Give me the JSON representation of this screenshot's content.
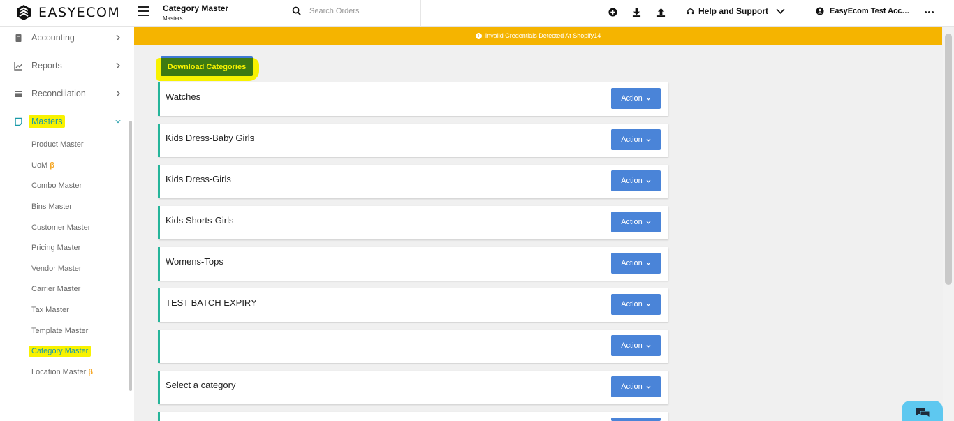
{
  "brand": {
    "name": "EASYECOM"
  },
  "header": {
    "title": "Category Master",
    "subtitle": "Masters",
    "search_placeholder": "Search Orders",
    "help_label": "Help and Support",
    "account_label": "EasyEcom Test Account"
  },
  "banner": {
    "text": "Invalid Credentials Detected At Shopify14"
  },
  "sidebar": {
    "items": [
      {
        "label": "Accounting",
        "icon": "receipt-icon"
      },
      {
        "label": "Reports",
        "icon": "chart-line-icon"
      },
      {
        "label": "Reconciliation",
        "icon": "wallet-icon"
      },
      {
        "label": "Masters",
        "icon": "note-icon"
      }
    ],
    "sub_items": [
      {
        "label": "Product Master"
      },
      {
        "label": "UoM",
        "beta": "β"
      },
      {
        "label": "Combo Master"
      },
      {
        "label": "Bins Master"
      },
      {
        "label": "Customer Master"
      },
      {
        "label": "Pricing Master"
      },
      {
        "label": "Vendor Master"
      },
      {
        "label": "Carrier Master"
      },
      {
        "label": "Tax Master"
      },
      {
        "label": "Template Master"
      },
      {
        "label": "Category Master"
      },
      {
        "label": "Location Master",
        "beta": "β"
      }
    ]
  },
  "main": {
    "download_label": "Download Categories",
    "action_label": "Action",
    "categories": [
      "Watches",
      "Kids Dress-Baby Girls",
      "Kids Dress-Girls",
      "Kids Shorts-Girls",
      "Womens-Tops",
      "TEST BATCH EXPIRY",
      "",
      "Select a category",
      ""
    ]
  },
  "colors": {
    "banner": "#f5b400",
    "accent": "#1a9aa8",
    "card_border": "#26b59a",
    "action_button": "#4a84d8",
    "highlight": "#f8f200"
  }
}
